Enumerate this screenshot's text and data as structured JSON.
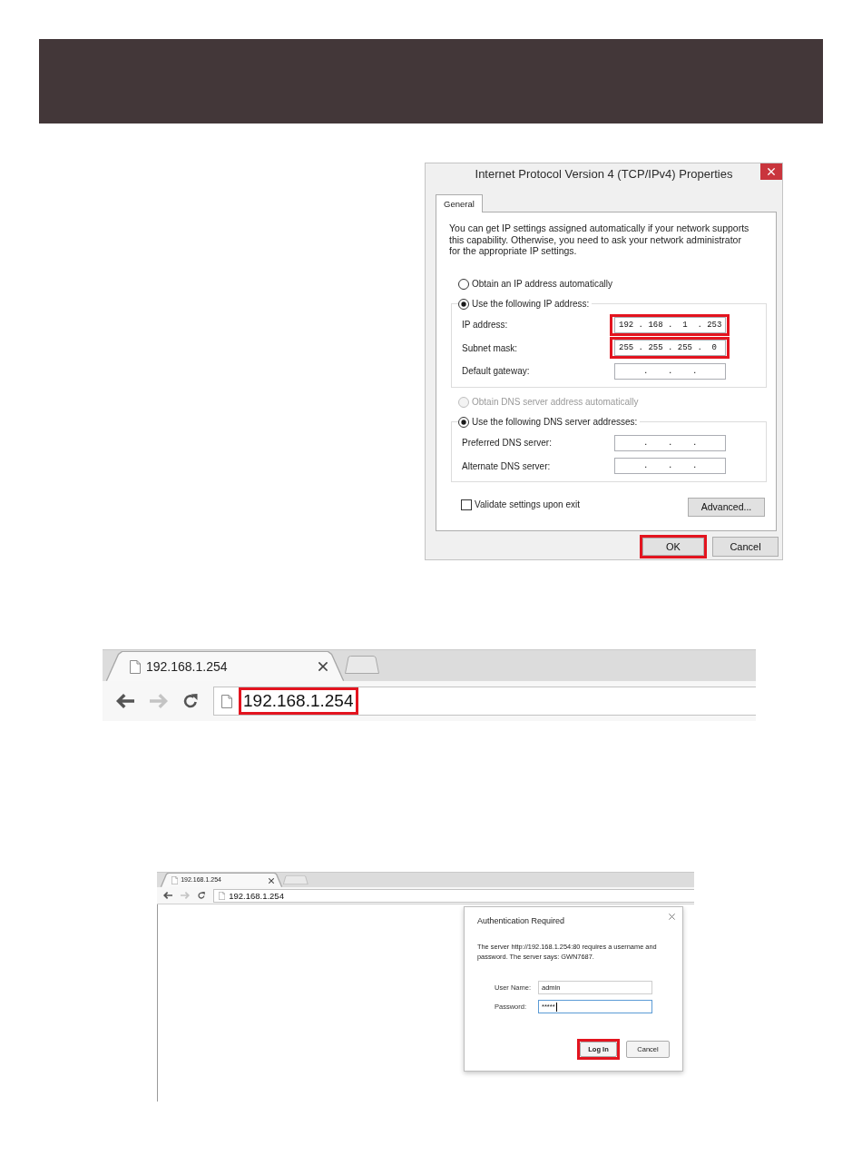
{
  "ipv4_dialog": {
    "title": "Internet Protocol Version 4 (TCP/IPv4) Properties",
    "tabs": [
      {
        "label": "General",
        "selected": true
      }
    ],
    "description": "You can get IP settings assigned automatically if your network supports\nthis capability. Otherwise, you need to ask your network administrator\nfor the appropriate IP settings.",
    "ip_section": {
      "auto_option": {
        "label": "Obtain an IP address automatically",
        "selected": false,
        "disabled": false
      },
      "manual_option": {
        "label": "Use the following IP address:",
        "selected": true,
        "disabled": false
      },
      "fields": [
        {
          "label": "IP address:",
          "value": "192 . 168 .  1  . 253",
          "highlighted": true
        },
        {
          "label": "Subnet mask:",
          "value": "255 . 255 . 255 .  0",
          "highlighted": true
        },
        {
          "label": "Default gateway:",
          "value": "     .    .    .",
          "highlighted": false
        }
      ]
    },
    "dns_section": {
      "auto_option": {
        "label": "Obtain DNS server address automatically",
        "selected": false,
        "disabled": true
      },
      "manual_option": {
        "label": "Use the following DNS server addresses:",
        "selected": true,
        "disabled": false
      },
      "fields": [
        {
          "label": "Preferred DNS server:",
          "value": "     .    .    .",
          "highlighted": false
        },
        {
          "label": "Alternate DNS server:",
          "value": "     .    .    .",
          "highlighted": false
        }
      ]
    },
    "validate_option": {
      "label": "Validate settings upon exit",
      "checked": false
    },
    "advanced_button": {
      "label": "Advanced..."
    },
    "buttons": [
      {
        "label": "OK",
        "highlighted": true
      },
      {
        "label": "Cancel",
        "highlighted": false
      }
    ]
  },
  "browser_address_bar": {
    "tabs": [
      {
        "title": "192.168.1.254",
        "selected": true
      }
    ],
    "nav_buttons": [
      {
        "kind": "back",
        "disabled": false
      },
      {
        "kind": "forward",
        "disabled": true
      },
      {
        "kind": "reload",
        "disabled": false
      }
    ],
    "address": {
      "url": "192.168.1.254",
      "highlighted": true
    }
  },
  "browser_login": {
    "tabs": [
      {
        "title": "192.168.1.254",
        "selected": true
      }
    ],
    "nav_buttons": [
      {
        "kind": "back",
        "disabled": false
      },
      {
        "kind": "forward",
        "disabled": true
      },
      {
        "kind": "reload",
        "disabled": false
      }
    ],
    "address": {
      "url": "192.168.1.254",
      "highlighted": false
    },
    "auth_dialog": {
      "title": "Authentication Required",
      "message": "The server http://192.168.1.254:80 requires a username and password. The server says: GWN7687.",
      "fields": [
        {
          "label": "User Name:",
          "value": "admin",
          "focused": false
        },
        {
          "label": "Password:",
          "value": "*****",
          "focused": true
        }
      ],
      "buttons": [
        {
          "label": "Log In",
          "highlighted": true,
          "default": true
        },
        {
          "label": "Cancel",
          "highlighted": false,
          "default": false
        }
      ]
    }
  }
}
